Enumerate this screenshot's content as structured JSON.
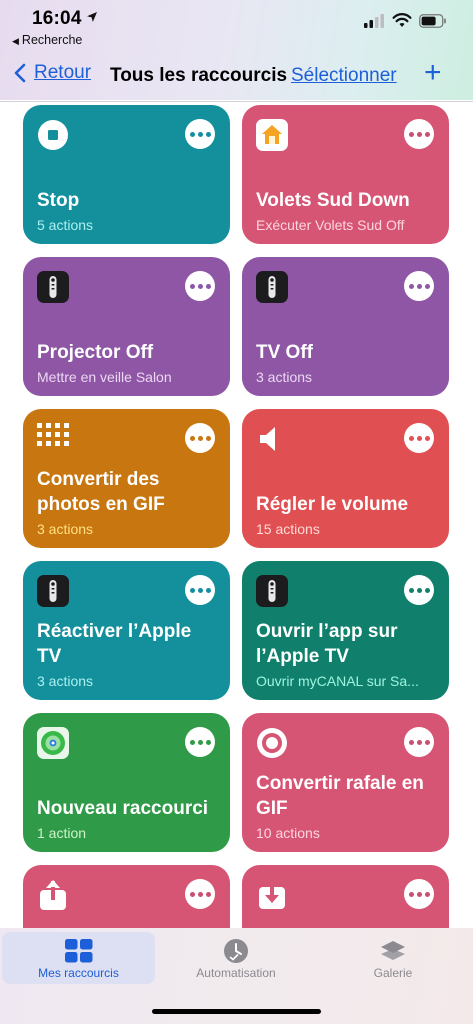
{
  "status": {
    "time": "16:04",
    "back_app": "Recherche"
  },
  "nav": {
    "back_label": "Retour",
    "title": "Tous les raccourcis",
    "select_label": "Sélectionner",
    "add_label": "+"
  },
  "shortcuts": [
    {
      "title": "Stop",
      "subtitle": "5 actions",
      "color": "teal",
      "icon": "stop-icon"
    },
    {
      "title": "Volets Sud Down",
      "subtitle": "Exécuter Volets Sud Off",
      "color": "pink",
      "icon": "home-app-icon"
    },
    {
      "title": "Projector Off",
      "subtitle": "Mettre en veille Salon",
      "color": "purple",
      "icon": "apple-tv-remote-icon"
    },
    {
      "title": "TV Off",
      "subtitle": "3 actions",
      "color": "purple",
      "icon": "apple-tv-remote-icon"
    },
    {
      "title": "Convertir des photos en GIF",
      "subtitle": "3 actions",
      "color": "orange",
      "icon": "grid-icon"
    },
    {
      "title": "Régler le volume",
      "subtitle": "15 actions",
      "color": "red",
      "icon": "speaker-icon"
    },
    {
      "title": "Réactiver l’Apple TV",
      "subtitle": "3 actions",
      "color": "teal",
      "icon": "apple-tv-remote-icon"
    },
    {
      "title": "Ouvrir l’app sur l’Apple TV",
      "subtitle": "Ouvrir myCANAL sur Sa...",
      "color": "green-teal",
      "icon": "apple-tv-remote-icon"
    },
    {
      "title": "Nouveau raccourci",
      "subtitle": "1 action",
      "color": "green",
      "icon": "find-my-icon"
    },
    {
      "title": "Convertir rafale en GIF",
      "subtitle": "10 actions",
      "color": "pink",
      "icon": "target-icon"
    },
    {
      "title": "",
      "subtitle": "",
      "color": "pink",
      "icon": "share-icon"
    },
    {
      "title": "",
      "subtitle": "",
      "color": "pink",
      "icon": "download-icon"
    }
  ],
  "tabs": [
    {
      "label": "Mes raccourcis",
      "icon": "grid-squares-icon",
      "active": true
    },
    {
      "label": "Automatisation",
      "icon": "clock-check-icon",
      "active": false
    },
    {
      "label": "Galerie",
      "icon": "layers-icon",
      "active": false
    }
  ]
}
